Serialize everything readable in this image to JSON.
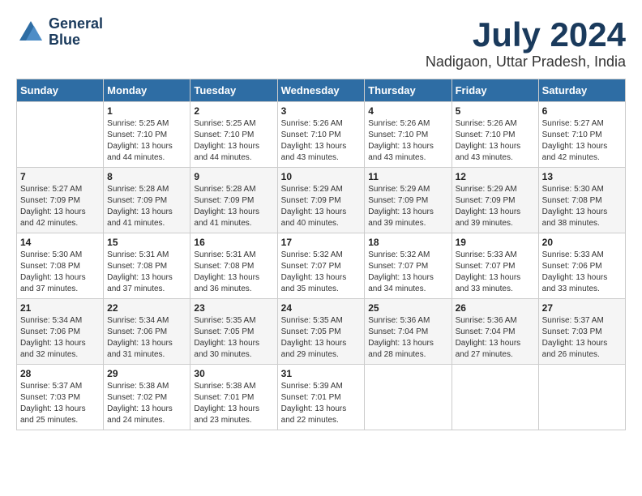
{
  "header": {
    "logo_line1": "General",
    "logo_line2": "Blue",
    "month_year": "July 2024",
    "location": "Nadigaon, Uttar Pradesh, India"
  },
  "weekdays": [
    "Sunday",
    "Monday",
    "Tuesday",
    "Wednesday",
    "Thursday",
    "Friday",
    "Saturday"
  ],
  "weeks": [
    [
      {
        "day": "",
        "sunrise": "",
        "sunset": "",
        "daylight": ""
      },
      {
        "day": "1",
        "sunrise": "Sunrise: 5:25 AM",
        "sunset": "Sunset: 7:10 PM",
        "daylight": "Daylight: 13 hours and 44 minutes."
      },
      {
        "day": "2",
        "sunrise": "Sunrise: 5:25 AM",
        "sunset": "Sunset: 7:10 PM",
        "daylight": "Daylight: 13 hours and 44 minutes."
      },
      {
        "day": "3",
        "sunrise": "Sunrise: 5:26 AM",
        "sunset": "Sunset: 7:10 PM",
        "daylight": "Daylight: 13 hours and 43 minutes."
      },
      {
        "day": "4",
        "sunrise": "Sunrise: 5:26 AM",
        "sunset": "Sunset: 7:10 PM",
        "daylight": "Daylight: 13 hours and 43 minutes."
      },
      {
        "day": "5",
        "sunrise": "Sunrise: 5:26 AM",
        "sunset": "Sunset: 7:10 PM",
        "daylight": "Daylight: 13 hours and 43 minutes."
      },
      {
        "day": "6",
        "sunrise": "Sunrise: 5:27 AM",
        "sunset": "Sunset: 7:10 PM",
        "daylight": "Daylight: 13 hours and 42 minutes."
      }
    ],
    [
      {
        "day": "7",
        "sunrise": "Sunrise: 5:27 AM",
        "sunset": "Sunset: 7:09 PM",
        "daylight": "Daylight: 13 hours and 42 minutes."
      },
      {
        "day": "8",
        "sunrise": "Sunrise: 5:28 AM",
        "sunset": "Sunset: 7:09 PM",
        "daylight": "Daylight: 13 hours and 41 minutes."
      },
      {
        "day": "9",
        "sunrise": "Sunrise: 5:28 AM",
        "sunset": "Sunset: 7:09 PM",
        "daylight": "Daylight: 13 hours and 41 minutes."
      },
      {
        "day": "10",
        "sunrise": "Sunrise: 5:29 AM",
        "sunset": "Sunset: 7:09 PM",
        "daylight": "Daylight: 13 hours and 40 minutes."
      },
      {
        "day": "11",
        "sunrise": "Sunrise: 5:29 AM",
        "sunset": "Sunset: 7:09 PM",
        "daylight": "Daylight: 13 hours and 39 minutes."
      },
      {
        "day": "12",
        "sunrise": "Sunrise: 5:29 AM",
        "sunset": "Sunset: 7:09 PM",
        "daylight": "Daylight: 13 hours and 39 minutes."
      },
      {
        "day": "13",
        "sunrise": "Sunrise: 5:30 AM",
        "sunset": "Sunset: 7:08 PM",
        "daylight": "Daylight: 13 hours and 38 minutes."
      }
    ],
    [
      {
        "day": "14",
        "sunrise": "Sunrise: 5:30 AM",
        "sunset": "Sunset: 7:08 PM",
        "daylight": "Daylight: 13 hours and 37 minutes."
      },
      {
        "day": "15",
        "sunrise": "Sunrise: 5:31 AM",
        "sunset": "Sunset: 7:08 PM",
        "daylight": "Daylight: 13 hours and 37 minutes."
      },
      {
        "day": "16",
        "sunrise": "Sunrise: 5:31 AM",
        "sunset": "Sunset: 7:08 PM",
        "daylight": "Daylight: 13 hours and 36 minutes."
      },
      {
        "day": "17",
        "sunrise": "Sunrise: 5:32 AM",
        "sunset": "Sunset: 7:07 PM",
        "daylight": "Daylight: 13 hours and 35 minutes."
      },
      {
        "day": "18",
        "sunrise": "Sunrise: 5:32 AM",
        "sunset": "Sunset: 7:07 PM",
        "daylight": "Daylight: 13 hours and 34 minutes."
      },
      {
        "day": "19",
        "sunrise": "Sunrise: 5:33 AM",
        "sunset": "Sunset: 7:07 PM",
        "daylight": "Daylight: 13 hours and 33 minutes."
      },
      {
        "day": "20",
        "sunrise": "Sunrise: 5:33 AM",
        "sunset": "Sunset: 7:06 PM",
        "daylight": "Daylight: 13 hours and 33 minutes."
      }
    ],
    [
      {
        "day": "21",
        "sunrise": "Sunrise: 5:34 AM",
        "sunset": "Sunset: 7:06 PM",
        "daylight": "Daylight: 13 hours and 32 minutes."
      },
      {
        "day": "22",
        "sunrise": "Sunrise: 5:34 AM",
        "sunset": "Sunset: 7:06 PM",
        "daylight": "Daylight: 13 hours and 31 minutes."
      },
      {
        "day": "23",
        "sunrise": "Sunrise: 5:35 AM",
        "sunset": "Sunset: 7:05 PM",
        "daylight": "Daylight: 13 hours and 30 minutes."
      },
      {
        "day": "24",
        "sunrise": "Sunrise: 5:35 AM",
        "sunset": "Sunset: 7:05 PM",
        "daylight": "Daylight: 13 hours and 29 minutes."
      },
      {
        "day": "25",
        "sunrise": "Sunrise: 5:36 AM",
        "sunset": "Sunset: 7:04 PM",
        "daylight": "Daylight: 13 hours and 28 minutes."
      },
      {
        "day": "26",
        "sunrise": "Sunrise: 5:36 AM",
        "sunset": "Sunset: 7:04 PM",
        "daylight": "Daylight: 13 hours and 27 minutes."
      },
      {
        "day": "27",
        "sunrise": "Sunrise: 5:37 AM",
        "sunset": "Sunset: 7:03 PM",
        "daylight": "Daylight: 13 hours and 26 minutes."
      }
    ],
    [
      {
        "day": "28",
        "sunrise": "Sunrise: 5:37 AM",
        "sunset": "Sunset: 7:03 PM",
        "daylight": "Daylight: 13 hours and 25 minutes."
      },
      {
        "day": "29",
        "sunrise": "Sunrise: 5:38 AM",
        "sunset": "Sunset: 7:02 PM",
        "daylight": "Daylight: 13 hours and 24 minutes."
      },
      {
        "day": "30",
        "sunrise": "Sunrise: 5:38 AM",
        "sunset": "Sunset: 7:01 PM",
        "daylight": "Daylight: 13 hours and 23 minutes."
      },
      {
        "day": "31",
        "sunrise": "Sunrise: 5:39 AM",
        "sunset": "Sunset: 7:01 PM",
        "daylight": "Daylight: 13 hours and 22 minutes."
      },
      {
        "day": "",
        "sunrise": "",
        "sunset": "",
        "daylight": ""
      },
      {
        "day": "",
        "sunrise": "",
        "sunset": "",
        "daylight": ""
      },
      {
        "day": "",
        "sunrise": "",
        "sunset": "",
        "daylight": ""
      }
    ]
  ]
}
